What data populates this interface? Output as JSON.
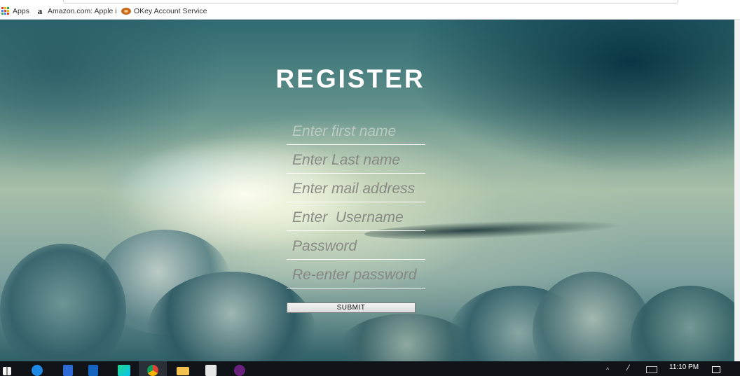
{
  "bookmarks": {
    "items": [
      {
        "label": "Apps",
        "icon": "apps-grid-icon"
      },
      {
        "label": "Amazon.com: Apple i",
        "icon": "amazon-icon"
      },
      {
        "label": "OKey Account Service",
        "icon": "okey-icon"
      }
    ]
  },
  "form": {
    "title": "REGISTER",
    "fields": [
      {
        "placeholder": "Enter first name",
        "value": ""
      },
      {
        "placeholder": "Enter Last name",
        "value": ""
      },
      {
        "placeholder": "Enter mail address",
        "value": ""
      },
      {
        "placeholder": "Enter  Username",
        "value": ""
      },
      {
        "placeholder": "Password",
        "value": ""
      },
      {
        "placeholder": "Re-enter password",
        "value": ""
      }
    ],
    "submit_label": "SUBMIT"
  },
  "taskbar": {
    "clock": "11:10 PM",
    "icons": [
      "windows-start-icon",
      "edge-icon",
      "store-icon",
      "outlook-icon",
      "webstorm-icon",
      "chrome-icon",
      "file-explorer-icon",
      "shopping-bag-icon",
      "visual-studio-icon"
    ]
  },
  "colors": {
    "title": "#ffffff",
    "field_underline": "#ffffff",
    "taskbar": "#101418"
  }
}
